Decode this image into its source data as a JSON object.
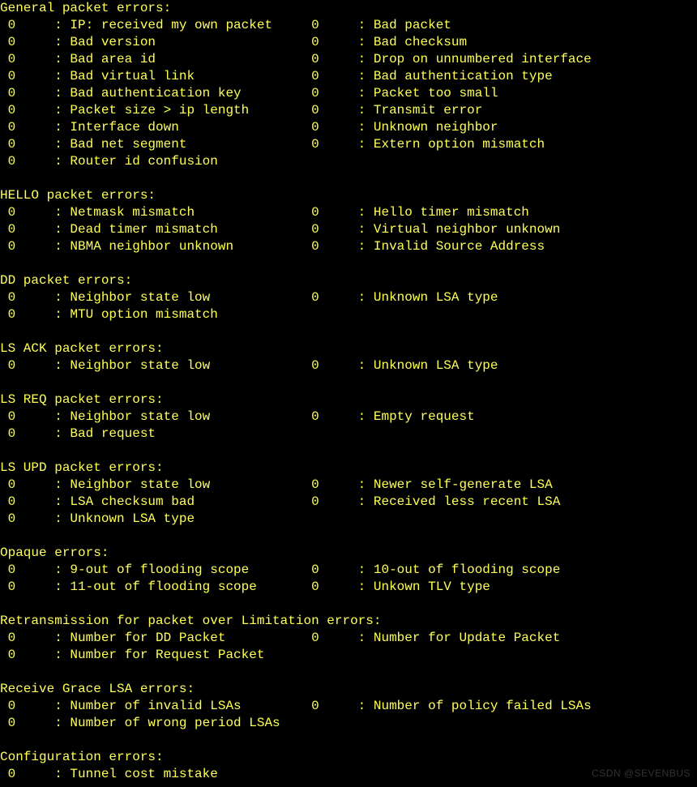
{
  "watermark": "CSDN @SEVENBUS",
  "sections": [
    {
      "title": "General packet errors:",
      "rows": [
        {
          "lv": 0,
          "ll": "IP: received my own packet",
          "rv": 0,
          "rl": "Bad packet"
        },
        {
          "lv": 0,
          "ll": "Bad version",
          "rv": 0,
          "rl": "Bad checksum"
        },
        {
          "lv": 0,
          "ll": "Bad area id",
          "rv": 0,
          "rl": "Drop on unnumbered interface"
        },
        {
          "lv": 0,
          "ll": "Bad virtual link",
          "rv": 0,
          "rl": "Bad authentication type"
        },
        {
          "lv": 0,
          "ll": "Bad authentication key",
          "rv": 0,
          "rl": "Packet too small"
        },
        {
          "lv": 0,
          "ll": "Packet size > ip length",
          "rv": 0,
          "rl": "Transmit error"
        },
        {
          "lv": 0,
          "ll": "Interface down",
          "rv": 0,
          "rl": "Unknown neighbor"
        },
        {
          "lv": 0,
          "ll": "Bad net segment",
          "rv": 0,
          "rl": "Extern option mismatch"
        },
        {
          "lv": 0,
          "ll": "Router id confusion"
        }
      ]
    },
    {
      "title": "HELLO packet errors:",
      "rows": [
        {
          "lv": 0,
          "ll": "Netmask mismatch",
          "rv": 0,
          "rl": "Hello timer mismatch"
        },
        {
          "lv": 0,
          "ll": "Dead timer mismatch",
          "rv": 0,
          "rl": "Virtual neighbor unknown"
        },
        {
          "lv": 0,
          "ll": "NBMA neighbor unknown",
          "rv": 0,
          "rl": "Invalid Source Address"
        }
      ]
    },
    {
      "title": "DD packet errors:",
      "rows": [
        {
          "lv": 0,
          "ll": "Neighbor state low",
          "rv": 0,
          "rl": "Unknown LSA type"
        },
        {
          "lv": 0,
          "ll": "MTU option mismatch"
        }
      ]
    },
    {
      "title": "LS ACK packet errors:",
      "rows": [
        {
          "lv": 0,
          "ll": "Neighbor state low",
          "rv": 0,
          "rl": "Unknown LSA type"
        }
      ]
    },
    {
      "title": "LS REQ packet errors:",
      "rows": [
        {
          "lv": 0,
          "ll": "Neighbor state low",
          "rv": 0,
          "rl": "Empty request"
        },
        {
          "lv": 0,
          "ll": "Bad request"
        }
      ]
    },
    {
      "title": "LS UPD packet errors:",
      "rows": [
        {
          "lv": 0,
          "ll": "Neighbor state low",
          "rv": 0,
          "rl": "Newer self-generate LSA"
        },
        {
          "lv": 0,
          "ll": "LSA checksum bad",
          "rv": 0,
          "rl": "Received less recent LSA"
        },
        {
          "lv": 0,
          "ll": "Unknown LSA type"
        }
      ]
    },
    {
      "title": "Opaque errors:",
      "rows": [
        {
          "lv": 0,
          "ll": "9-out of flooding scope",
          "rv": 0,
          "rl": "10-out of flooding scope"
        },
        {
          "lv": 0,
          "ll": "11-out of flooding scope",
          "rv": 0,
          "rl": "Unkown TLV type"
        }
      ]
    },
    {
      "title": "Retransmission for packet over Limitation errors:",
      "rows": [
        {
          "lv": 0,
          "ll": "Number for DD Packet",
          "rv": 0,
          "rl": "Number for Update Packet"
        },
        {
          "lv": 0,
          "ll": "Number for Request Packet"
        }
      ]
    },
    {
      "title": "Receive Grace LSA errors:",
      "rows": [
        {
          "lv": 0,
          "ll": "Number of invalid LSAs",
          "rv": 0,
          "rl": "Number of policy failed LSAs"
        },
        {
          "lv": 0,
          "ll": "Number of wrong period LSAs"
        }
      ]
    },
    {
      "title": "Configuration errors:",
      "rows": [
        {
          "lv": 0,
          "ll": "Tunnel cost mistake"
        }
      ]
    }
  ]
}
